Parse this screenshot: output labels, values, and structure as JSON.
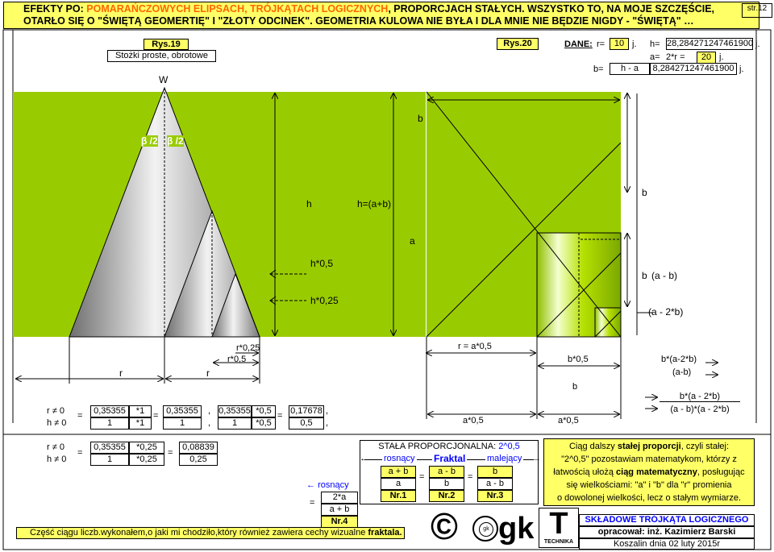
{
  "header": {
    "line1_a": "EFEKTY PO: ",
    "line1_b": "POMARAŃCZOWYCH ELIPSACH, TRÓJKĄTACH LOGICZNYCH",
    "line1_c": ", PROPORCJACH STAŁYCH. WSZYSTKO TO, NA MOJE SZCZĘŚCIE,",
    "line2": "OTARŁO SIĘ O \"ŚWIĘTĄ GEOMERTIĘ\" I \"ZŁOTY ODCINEK\". GEOMETRIA KULOWA NIE BYŁA I DLA MNIE NIE BĘDZIE NIGDY - \"ŚWIĘTĄ\" …",
    "page": "str.12"
  },
  "fig19": {
    "title": "Rys.19",
    "subtitle": "Stożki proste, obrotowe",
    "apex": "W",
    "beta1": "β /2",
    "beta2": "β /2"
  },
  "fig20": {
    "title": "Rys.20"
  },
  "dane": {
    "label": "DANE:",
    "r_lbl": "r=",
    "r_val": "10",
    "unit": "j.",
    "h_lbl": "h=",
    "h_val": "28,284271247461900",
    "a_lbl": "a=",
    "a_formula": "2*r =",
    "a_val": "20",
    "b_lbl": "b=",
    "b_formula": "h - a",
    "b_val": "8,284271247461900"
  },
  "labels": {
    "h": "h",
    "h_ab": "h=(a+b)",
    "h05": "h*0,5",
    "h025": "h*0,25",
    "b_top": "b",
    "b_mid": "b",
    "a": "a",
    "b_small": "b",
    "a_minus_b": "(a - b)",
    "a_minus_2b": "(a - 2*b)",
    "r1": "r",
    "r2": "r",
    "r05": "r*0,5",
    "r025": "r*0,25",
    "r_eq": "r = a*0,5",
    "b05": "b*0,5",
    "b_center": "b",
    "b_a2b": "b*(a-2*b)",
    "amb": "(a-b)",
    "a05_1": "a*0,5",
    "a05_2": "a*0,5",
    "frac_num": "b*(a - 2*b)",
    "frac_den": "(a - b)*(a - 2*b)"
  },
  "ratio1": {
    "rne": "r ≠ 0",
    "hne": "h ≠ 0",
    "eq": "=",
    "c1n": "0,35355",
    "c1m": "*1",
    "c1d": "1",
    "c1dm": "*1",
    "c2n": "0,35355",
    "c2d": "1",
    "comma": ",",
    "c3n": "0,35355",
    "c3m": "*0,5",
    "c3d": "1",
    "c3dm": "*0,5",
    "c4n": "0,17678",
    "c4d": "0,5"
  },
  "ratio2": {
    "rne": "r ≠ 0",
    "hne": "h ≠ 0",
    "eq": "=",
    "n": "0,35355",
    "nm": "*0,25",
    "d": "1",
    "dm": "*0,25",
    "rn": "0,08839",
    "rd": "0,25"
  },
  "prop": {
    "title_a": "STAŁA PROPORCJONALNA: ",
    "title_b": "2^0,5",
    "ros": "rosnący",
    "fraktal": "Fraktal",
    "mal": "malejący",
    "f1n": "a + b",
    "f1d": "a",
    "f2n": "a - b",
    "f2d": "b",
    "f3n": "b",
    "f3d": "a - b",
    "nr1": "Nr.1",
    "nr2": "Nr.2",
    "nr3": "Nr.3",
    "ros2": "rosnący",
    "f4n": "2*a",
    "f4d": "a + b",
    "nr4": "Nr.4"
  },
  "ciag": {
    "l1a": "Ciąg dalszy ",
    "l1b": "stałej proporcji",
    ", czyli stałej:": "",
    "l1c": ", czyli stałej:",
    "l2": "\"2^0,5\" pozostawiam matematykom, którzy z",
    "l3a": "łatwością ułożą ",
    "l3b": "ciąg matematyczny",
    ", posługując": "",
    "l3c": ", posługując",
    "l4": "się wielkościami: \"a\" i \"b\" dla \"r\" promienia",
    "l5": "o dowolonej wielkości, lecz o stałym wymiarze."
  },
  "footer": {
    "note_a": "Część ciągu liczb.wykonałem,o jaki mi chodziło,który również zawiera cechy wizualne ",
    "note_b": "fraktala.",
    "copy": "©",
    "gk": "gk",
    "T": "T",
    "technika": "TECHNIKA",
    "sklad": "SKŁADOWE TRÓJKĄTA LOGICZNEGO",
    "oprac_lbl": "opracował:",
    "oprac": "inż. Kazimierz Barski",
    "date": "Koszalin dnia 02 luty 2015r"
  },
  "colors": {
    "green": "#99cc00",
    "yellow": "#ffff66",
    "blue": "#0000ff",
    "orange": "#ff6600"
  }
}
